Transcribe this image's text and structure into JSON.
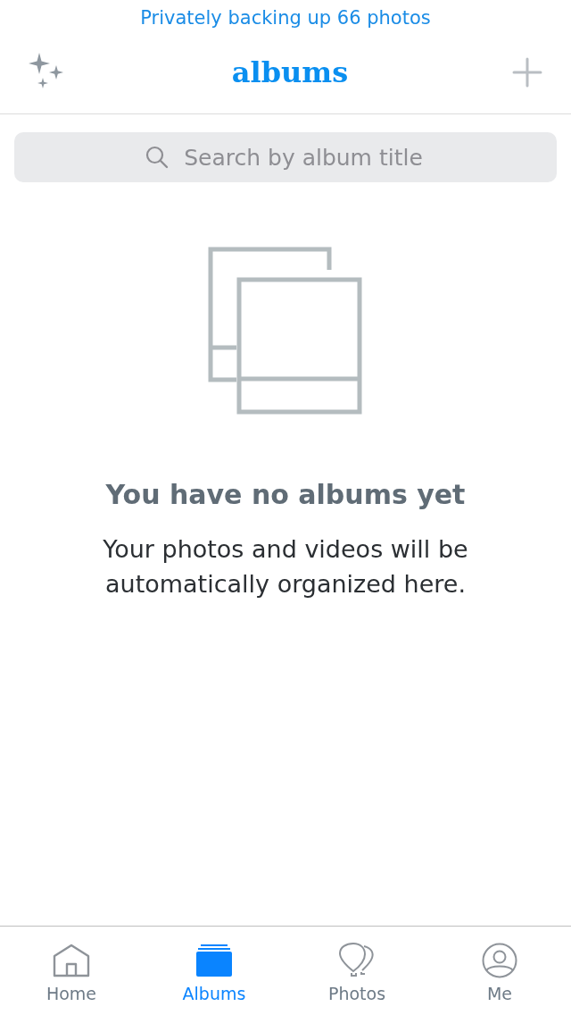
{
  "banner": "Privately backing up 66 photos",
  "header": {
    "title": "albums"
  },
  "search": {
    "placeholder": "Search by album title"
  },
  "empty_state": {
    "heading": "You have no albums yet",
    "message": "Your photos and videos will be automatically organized here."
  },
  "tabs": [
    {
      "kind": "home",
      "label": "Home",
      "selected": false
    },
    {
      "kind": "albums",
      "label": "Albums",
      "selected": true
    },
    {
      "kind": "photos",
      "label": "Photos",
      "selected": false
    },
    {
      "kind": "me",
      "label": "Me",
      "selected": false
    }
  ]
}
